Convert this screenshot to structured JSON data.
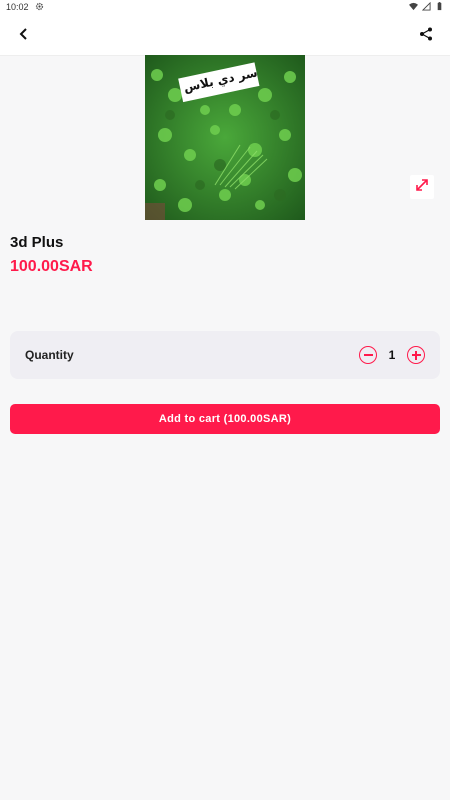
{
  "status_bar": {
    "time": "10:02",
    "icons": [
      "settings-icon",
      "wifi-icon",
      "signal-icon",
      "battery-icon"
    ]
  },
  "app_bar": {
    "back_icon": "chevron-left-icon",
    "share_icon": "share-icon"
  },
  "product": {
    "image_caption": "سر دي بلاس",
    "name": "3d Plus",
    "price": "100.00SAR",
    "expand_icon": "expand-icon"
  },
  "quantity": {
    "label": "Quantity",
    "value": "1",
    "decrement_icon": "minus-circle-icon",
    "increment_icon": "plus-circle-icon"
  },
  "cart": {
    "button_label": "Add to cart (100.00SAR)"
  },
  "colors": {
    "accent": "#ff1a4b",
    "background": "#f7f7f8",
    "card": "#efeef3"
  }
}
